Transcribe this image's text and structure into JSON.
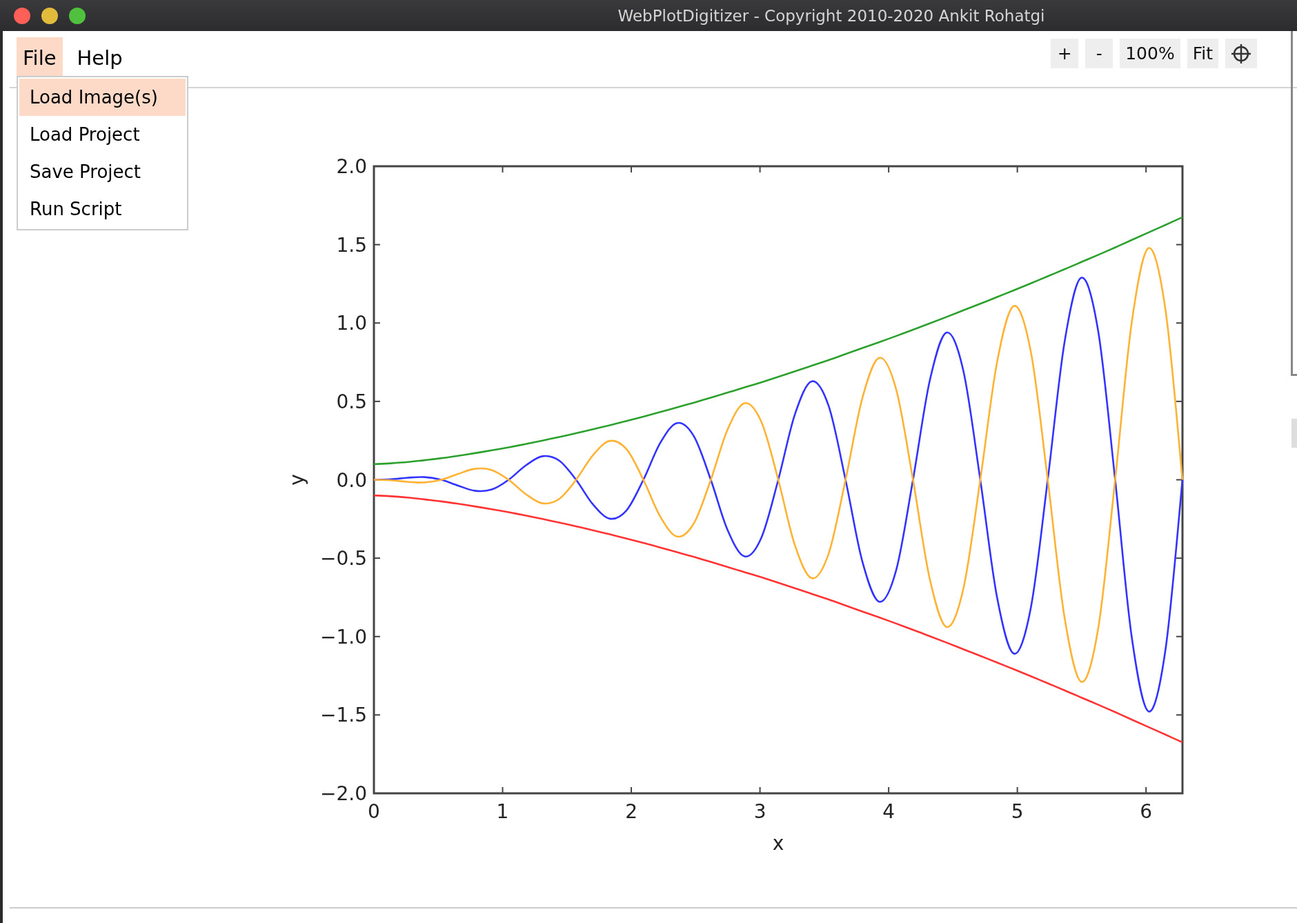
{
  "window": {
    "title": "WebPlotDigitizer - Copyright 2010-2020 Ankit Rohatgi"
  },
  "menu": [
    {
      "label": "File",
      "selected": true
    },
    {
      "label": "Help",
      "selected": false
    }
  ],
  "file_menu": [
    {
      "label": "Load Image(s)",
      "selected": true
    },
    {
      "label": "Load Project",
      "selected": false
    },
    {
      "label": "Save Project",
      "selected": false
    },
    {
      "label": "Run Script",
      "selected": false
    }
  ],
  "toolbar": {
    "buttons": [
      "+",
      "-",
      "100%",
      "Fit"
    ]
  },
  "plot": {
    "chart_data": {
      "type": "line",
      "xlabel": "x",
      "ylabel": "y",
      "xlim": [
        0,
        6.2832
      ],
      "ylim": [
        -2,
        2
      ],
      "xticks": [
        0,
        1,
        2,
        3,
        4,
        5,
        6
      ],
      "yticks": [
        {
          "value": -2,
          "label": "−2.0"
        },
        {
          "value": -1.5,
          "label": "−1.5"
        },
        {
          "value": -1,
          "label": "−1.0"
        },
        {
          "value": -0.5,
          "label": "−0.5"
        },
        {
          "value": 0,
          "label": "0.0"
        },
        {
          "value": 0.5,
          "label": "0.5"
        },
        {
          "value": 1,
          "label": "1.0"
        },
        {
          "value": 1.5,
          "label": "1.5"
        },
        {
          "value": 2,
          "label": "2.0"
        }
      ],
      "x": [
        0,
        0.131,
        0.262,
        0.393,
        0.524,
        0.654,
        0.785,
        0.916,
        1.047,
        1.178,
        1.309,
        1.44,
        1.571,
        1.702,
        1.833,
        1.963,
        2.094,
        2.225,
        2.356,
        2.487,
        2.618,
        2.749,
        2.88,
        3.011,
        3.142,
        3.272,
        3.403,
        3.534,
        3.665,
        3.796,
        3.927,
        4.058,
        4.189,
        4.32,
        4.451,
        4.581,
        4.712,
        4.843,
        4.974,
        5.105,
        5.236,
        5.367,
        5.498,
        5.629,
        5.76,
        5.89,
        6.021,
        6.152,
        6.283
      ],
      "series": [
        {
          "color": "#2ca02c",
          "values": [
            0.1,
            0.105,
            0.113,
            0.125,
            0.138,
            0.153,
            0.17,
            0.188,
            0.207,
            0.228,
            0.25,
            0.273,
            0.297,
            0.322,
            0.348,
            0.375,
            0.403,
            0.432,
            0.462,
            0.492,
            0.524,
            0.556,
            0.589,
            0.622,
            0.657,
            0.692,
            0.728,
            0.764,
            0.802,
            0.84,
            0.878,
            0.917,
            0.957,
            0.998,
            1.039,
            1.081,
            1.123,
            1.166,
            1.209,
            1.253,
            1.298,
            1.343,
            1.389,
            1.435,
            1.482,
            1.53,
            1.578,
            1.626,
            1.675
          ]
        },
        {
          "color": "#ff3333",
          "values": [
            -0.1,
            -0.105,
            -0.113,
            -0.125,
            -0.138,
            -0.153,
            -0.17,
            -0.188,
            -0.207,
            -0.228,
            -0.25,
            -0.273,
            -0.297,
            -0.322,
            -0.348,
            -0.375,
            -0.403,
            -0.432,
            -0.462,
            -0.492,
            -0.524,
            -0.556,
            -0.589,
            -0.622,
            -0.657,
            -0.692,
            -0.728,
            -0.764,
            -0.802,
            -0.84,
            -0.878,
            -0.917,
            -0.957,
            -0.998,
            -1.039,
            -1.081,
            -1.123,
            -1.166,
            -1.209,
            -1.253,
            -1.298,
            -1.343,
            -1.389,
            -1.435,
            -1.482,
            -1.53,
            -1.578,
            -1.626,
            -1.675
          ]
        },
        {
          "color": "#3333ff",
          "values": [
            0,
            0.003,
            0.013,
            0.017,
            0,
            -0.037,
            -0.07,
            -0.062,
            0,
            0.09,
            0.15,
            0.122,
            0,
            -0.157,
            -0.248,
            -0.195,
            0,
            0.235,
            0.362,
            0.277,
            0,
            -0.322,
            -0.489,
            -0.369,
            0,
            0.419,
            0.628,
            0.47,
            0,
            -0.523,
            -0.778,
            -0.578,
            0,
            0.635,
            0.939,
            0.693,
            0,
            -0.754,
            -1.109,
            -0.816,
            0,
            0.879,
            1.289,
            0.944,
            0,
            -1.011,
            -1.478,
            -1.079,
            0
          ]
        },
        {
          "color": "#ffb233",
          "values": [
            0,
            -0.003,
            -0.013,
            -0.017,
            0,
            0.037,
            0.07,
            0.062,
            0,
            -0.09,
            -0.15,
            -0.122,
            0,
            0.157,
            0.248,
            0.195,
            0,
            -0.235,
            -0.362,
            -0.277,
            0,
            0.322,
            0.489,
            0.369,
            0,
            -0.419,
            -0.628,
            -0.47,
            0,
            0.523,
            0.778,
            0.578,
            0,
            -0.635,
            -0.939,
            -0.693,
            0,
            0.754,
            1.109,
            0.816,
            0,
            -0.879,
            -1.289,
            -0.944,
            0,
            1.011,
            1.478,
            1.079,
            0
          ]
        }
      ]
    }
  }
}
